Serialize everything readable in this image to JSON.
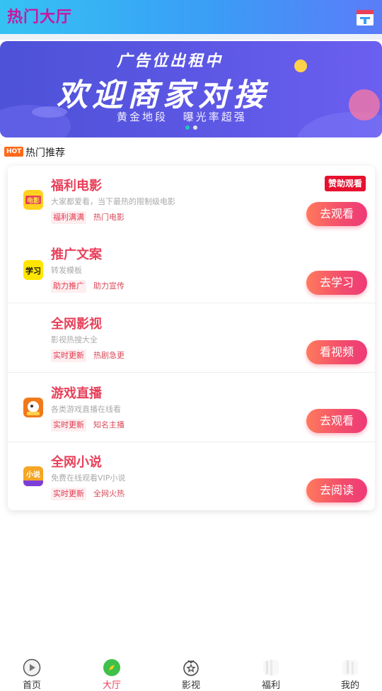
{
  "header": {
    "title": "热门大厅",
    "icon": "calendar-icon"
  },
  "banner": {
    "line1": "广告位出租中",
    "line2": "欢迎商家对接",
    "line3": "黄金地段 曝光率超强",
    "colors": {
      "bg": "#5a56e2",
      "accent_active": "#1fc8b8",
      "accent_inactive": "#ffffff"
    }
  },
  "section": {
    "badge": "HOT",
    "title": "热门推荐"
  },
  "items": [
    {
      "title": "福利电影",
      "desc": "大家都爱看，当下最热的限制级电影",
      "tags": [
        "福利满满",
        "热门电影"
      ],
      "button": "去观看",
      "badge": "赞助观看",
      "icon": "film-icon"
    },
    {
      "title": "推广文案",
      "desc": "转发模板",
      "tags": [
        "助力推广",
        "助力宣传"
      ],
      "button": "去学习",
      "icon": "study-icon"
    },
    {
      "title": "全网影视",
      "desc": "影视热搜大全",
      "tags": [
        "实时更新",
        "热剧急更"
      ],
      "button": "看视频",
      "icon": ""
    },
    {
      "title": "游戏直播",
      "desc": "各类游戏直播在线看",
      "tags": [
        "实时更新",
        "知名主播"
      ],
      "button": "去观看",
      "icon": "game-icon"
    },
    {
      "title": "全网小说",
      "desc": "免费在线观看VIP小说",
      "tags": [
        "实时更新",
        "全网火热"
      ],
      "button": "去阅读",
      "icon": "novel-icon"
    }
  ],
  "tabbar": [
    {
      "label": "首页",
      "icon": "play-icon",
      "active": false
    },
    {
      "label": "大厅",
      "icon": "compass-icon",
      "active": true
    },
    {
      "label": "影视",
      "icon": "star-badge-icon",
      "active": false
    },
    {
      "label": "福利",
      "icon": "gift-icon",
      "active": false
    },
    {
      "label": "我的",
      "icon": "user-icon",
      "active": false
    }
  ]
}
